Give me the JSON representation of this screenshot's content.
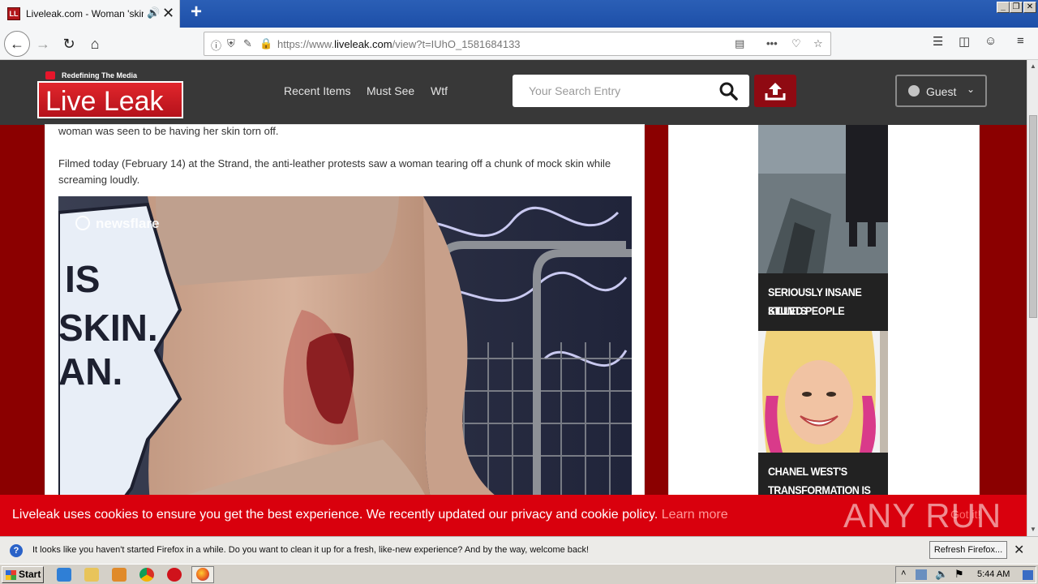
{
  "browser": {
    "tab_title": "Liveleak.com - Woman 'skinned' alive",
    "tab_favicon": "LL",
    "url_prefix": "https://www.",
    "url_domain": "liveleak.com",
    "url_path": "/view?t=IUhO_1581684133"
  },
  "site": {
    "tagline": "Redefining The Media",
    "logo_live": "Live",
    "logo_leak": "Leak",
    "nav": [
      "Recent Items",
      "Must See",
      "Wtf"
    ],
    "search_placeholder": "Your Search Entry",
    "account_label": "Guest"
  },
  "article": {
    "para1_tail": "woman was seen to be having her skin torn off.",
    "para2": "Filmed today (February 14) at the Strand, the anti-leather protests saw a woman tearing off a chunk of mock skin while screaming loudly.",
    "video_watermark": "newsflare",
    "sign_lines": [
      "IS",
      "SKIN.",
      "AN."
    ]
  },
  "sidebar": {
    "cards": [
      {
        "caption_line1": "SERIOUSLY INSANE STUNTS",
        "caption_line2": "KILLED PEOPLE"
      },
      {
        "caption_line1": "CHANEL WEST'S",
        "caption_line2": "TRANSFORMATION IS"
      }
    ]
  },
  "cookie": {
    "message": "Liveleak uses cookies to ensure you get the best experience. We recently updated our privacy and cookie policy.",
    "learn_more": "Learn more",
    "got_it": "Got it!"
  },
  "watermark": "ANY RUN",
  "notification": {
    "text": "It looks like you haven't started Firefox in a while. Do you want to clean it up for a fresh, like-new experience? And by the way, welcome back!",
    "button": "Refresh Firefox..."
  },
  "taskbar": {
    "start": "Start",
    "clock": "5:44 AM"
  },
  "colors": {
    "brand_red": "#d9000d",
    "page_bg": "#8b0000",
    "header_bg": "#383838"
  }
}
